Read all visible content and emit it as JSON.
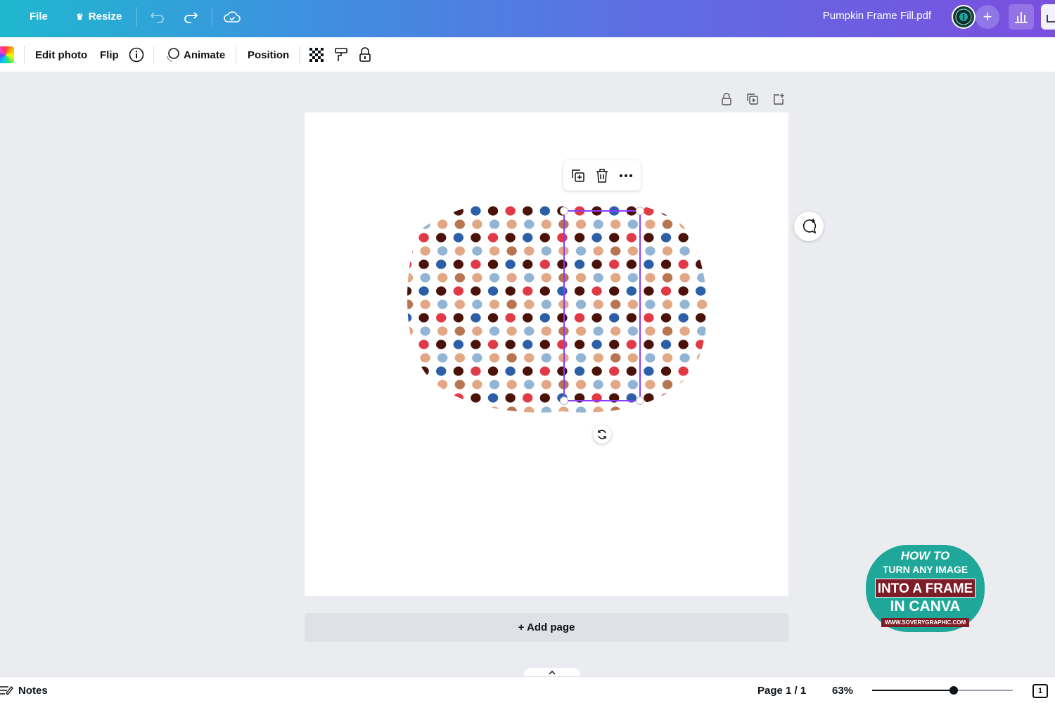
{
  "topbar": {
    "file_label": "File",
    "resize_label": "Resize",
    "document_title": "Pumpkin Frame Fill.pdf",
    "plus_label": "+"
  },
  "toolbar": {
    "edit_photo_label": "Edit photo",
    "flip_label": "Flip",
    "animate_label": "Animate",
    "position_label": "Position"
  },
  "canvas": {
    "add_page_label": "+ Add page",
    "dot_colors": [
      "#2c5fa8",
      "#4a1208",
      "#e03a46",
      "#e2a785",
      "#93b5d5",
      "#b87552"
    ]
  },
  "badge": {
    "line1": "HOW TO",
    "line2": "TURN ANY IMAGE",
    "line3": "INTO A FRAME",
    "line4": "IN CANVA",
    "url": "WWW.SOVERYGRAPHIC.COM"
  },
  "footer": {
    "notes_label": "Notes",
    "page_indicator": "Page 1 / 1",
    "zoom_label": "63%",
    "zoom_level": 0.63,
    "pages_count": "1"
  },
  "colors": {
    "selection": "#8b3dff",
    "badge_bg": "#1fa89a",
    "badge_accent": "#7e1d27"
  }
}
